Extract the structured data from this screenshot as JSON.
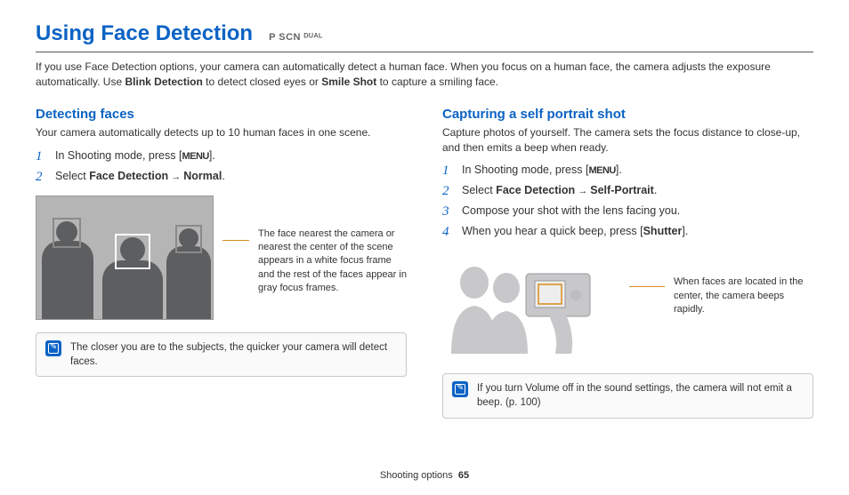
{
  "header": {
    "title": "Using Face Detection",
    "modes": "P  SCN  ᴰᵁᴬᴸ"
  },
  "intro": {
    "text_before_b1": "If you use Face Detection options, your camera can automatically detect a human face. When you focus on a human face, the camera adjusts the exposure automatically. Use ",
    "b1": "Blink Detection",
    "text_mid": " to detect closed eyes or ",
    "b2": "Smile Shot",
    "text_after": " to capture a smiling face."
  },
  "left": {
    "heading": "Detecting faces",
    "desc": "Your camera automatically detects up to 10 human faces in one scene.",
    "step1_pre": "In Shooting mode, press [",
    "step1_key": "MENU",
    "step1_post": "].",
    "step2_pre": "Select ",
    "step2_b1": "Face Detection",
    "step2_arrow": " → ",
    "step2_b2": "Normal",
    "step2_post": ".",
    "callout": "The face nearest the camera or nearest the center of the scene appears in a white focus frame and the rest of the faces appear in gray focus frames.",
    "note": "The closer you are to the subjects, the quicker your camera will detect faces."
  },
  "right": {
    "heading": "Capturing a self portrait shot",
    "desc": "Capture photos of yourself. The camera sets the focus distance to close-up, and then emits a beep when ready.",
    "step1_pre": "In Shooting mode, press [",
    "step1_key": "MENU",
    "step1_post": "].",
    "step2_pre": "Select ",
    "step2_b1": "Face Detection",
    "step2_arrow": " → ",
    "step2_b2": "Self-Portrait",
    "step2_post": ".",
    "step3": "Compose your shot with the lens facing you.",
    "step4_pre": "When you hear a quick beep, press [",
    "step4_b": "Shutter",
    "step4_post": "].",
    "callout": "When faces are located in the center, the camera beeps rapidly.",
    "note": "If you turn Volume off in the sound settings, the camera will not emit a beep. (p. 100)"
  },
  "footer": {
    "section": "Shooting options",
    "page": "65"
  }
}
